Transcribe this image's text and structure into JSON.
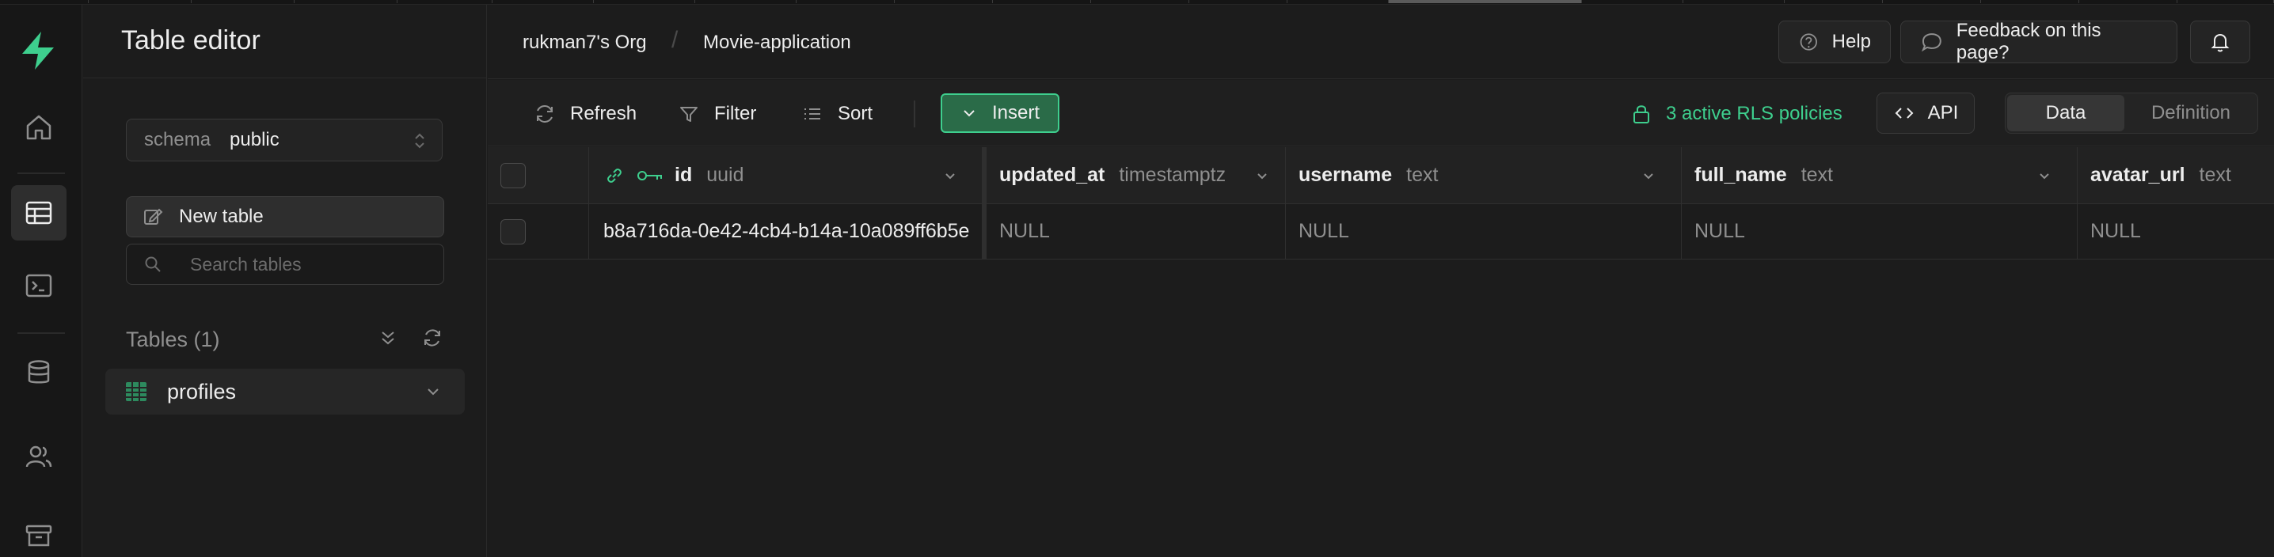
{
  "sidebar": {
    "title": "Table editor",
    "schema_label": "schema",
    "schema_value": "public",
    "new_table_label": "New table",
    "search_placeholder": "Search tables",
    "tables_heading": "Tables (1)",
    "tables": [
      {
        "name": "profiles"
      }
    ]
  },
  "header": {
    "org": "rukman7's Org",
    "project": "Movie-application",
    "separator": "/",
    "help_label": "Help",
    "feedback_label": "Feedback on this page?"
  },
  "toolbar": {
    "refresh_label": "Refresh",
    "filter_label": "Filter",
    "sort_label": "Sort",
    "insert_label": "Insert",
    "rls_label": "3 active RLS policies",
    "api_label": "API",
    "view_data_label": "Data",
    "view_definition_label": "Definition"
  },
  "grid": {
    "columns": [
      {
        "name": "id",
        "type": "uuid"
      },
      {
        "name": "updated_at",
        "type": "timestamptz"
      },
      {
        "name": "username",
        "type": "text"
      },
      {
        "name": "full_name",
        "type": "text"
      },
      {
        "name": "avatar_url",
        "type": "text"
      }
    ],
    "rows": [
      [
        "b8a716da-0e42-4cb4-b14a-10a089ff6b5e",
        "NULL",
        "NULL",
        "NULL",
        "NULL"
      ]
    ]
  },
  "colors": {
    "brand": "#3ecf8e",
    "background": "#1c1c1c",
    "insert_bg": "#2a6b48"
  },
  "icons": {
    "rail": [
      "supabase-logo-icon",
      "home-icon",
      "table-editor-icon",
      "sql-editor-icon",
      "database-icon",
      "users-icon",
      "storage-icon"
    ]
  }
}
